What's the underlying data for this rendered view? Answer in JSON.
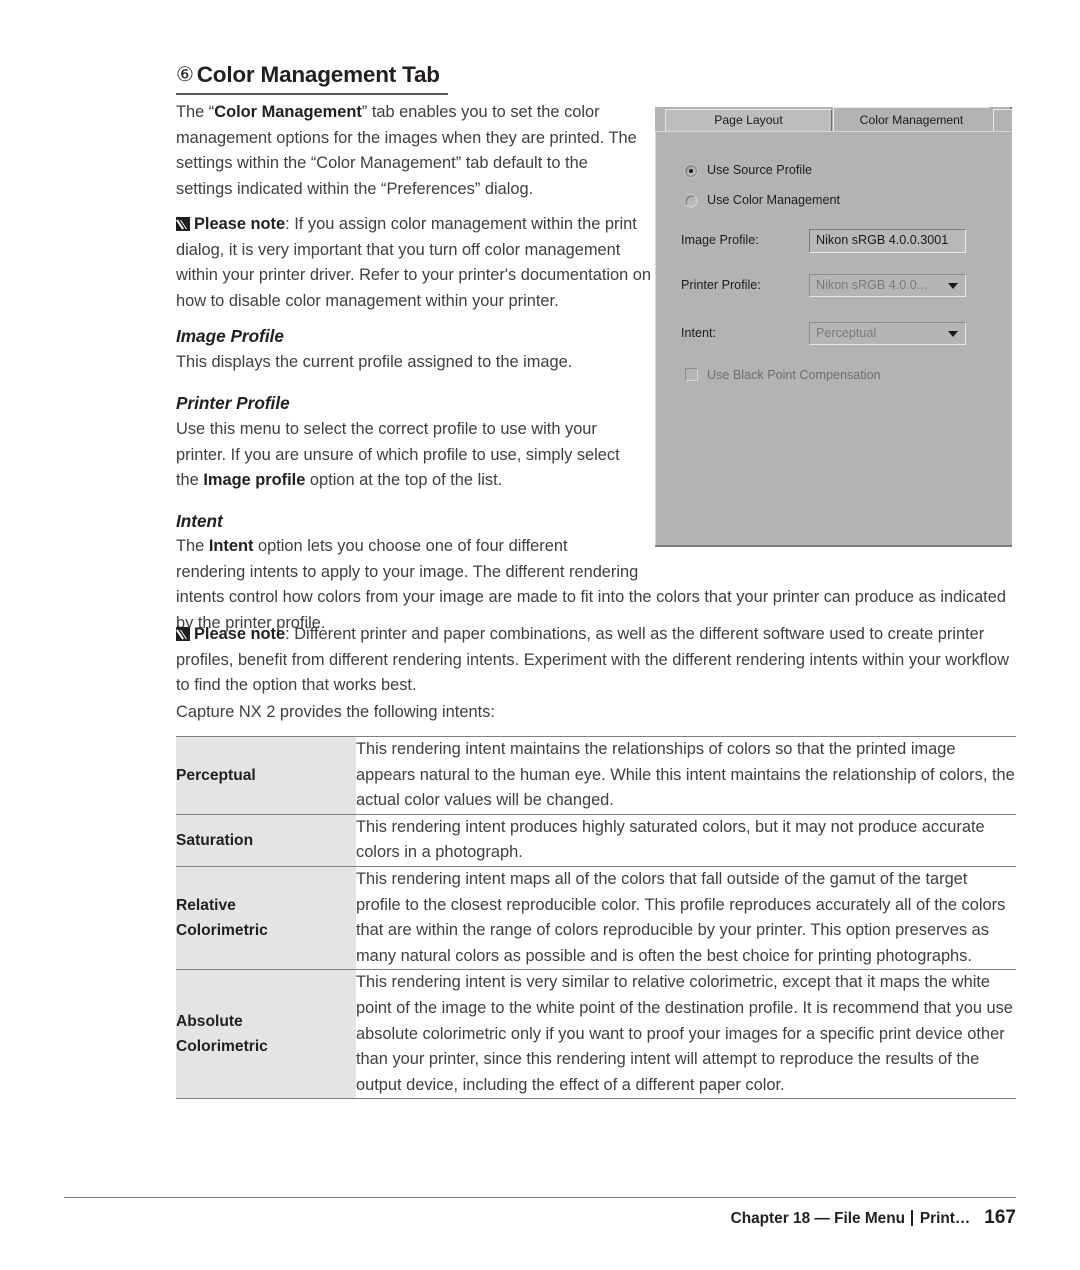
{
  "heading": {
    "marker": "⑥",
    "text": "Color Management Tab"
  },
  "paragraphs": {
    "intro_pre": "The “",
    "intro_bold": "Color Management",
    "intro_post": "” tab enables you to set the color management options for the images when they are printed. The settings within the “Color Management” tab default to the settings indicated within the “Preferences” dialog.",
    "note1_label": "Please note",
    "note1_text": ": If you assign color management within the print dialog, it is very important that you turn off color management within your printer driver. Refer to your printer's documentation on how to disable color management within your printer.",
    "image_profile_body": "This displays the current profile assigned to the image.",
    "printer_profile_pre": "Use this menu to select the correct profile to use with your printer. If you are unsure of which profile to use, simply select the ",
    "printer_profile_bold": "Image profile",
    "printer_profile_post": " option at the top of the list.",
    "intent_pre": "The ",
    "intent_bold": "Intent",
    "intent_post": " option lets you choose one of four different rendering intents to apply to your image. The different rendering intents control how colors from your image are made to fit into the colors that your printer can produce as indicated by the printer profile.",
    "note2_label": "Please note",
    "note2_text": ": Different printer and paper combinations, as well as the different software used to create printer profiles, benefit from different rendering intents. Experiment with the different rendering intents within your workflow to find the option that works best.",
    "capture_line": "Capture NX 2 provides the following intents:"
  },
  "subheads": {
    "image_profile": "Image Profile",
    "printer_profile": "Printer Profile",
    "intent": "Intent"
  },
  "dialog": {
    "tabs": [
      {
        "label": "Page Layout",
        "active": false
      },
      {
        "label": "Color Management",
        "active": true
      }
    ],
    "radios": [
      {
        "label": "Use Source Profile",
        "checked": true
      },
      {
        "label": "Use Color Management",
        "checked": false
      }
    ],
    "fields": [
      {
        "label": "Image Profile:",
        "value": "Nikon sRGB 4.0.0.3001",
        "control": "textfield",
        "disabled": false
      },
      {
        "label": "Printer Profile:",
        "value": "Nikon sRGB 4.0.0...",
        "control": "combobox",
        "disabled": true
      },
      {
        "label": "Intent:",
        "value": "Perceptual",
        "control": "combobox",
        "disabled": true
      }
    ],
    "checkbox": {
      "label": "Use Black Point Compensation",
      "checked": false,
      "disabled": true
    }
  },
  "intents_table": {
    "rows": [
      {
        "name": "Perceptual",
        "description": "This rendering intent maintains the relationships of colors so that the printed image appears natural to the human eye. While this intent maintains the relationship of colors, the actual color values will be changed."
      },
      {
        "name": "Saturation",
        "description": "This rendering intent produces highly saturated colors, but it may not produce accurate colors in a photograph."
      },
      {
        "name": "Relative Colorimetric",
        "description": "This rendering intent maps all of the colors that fall outside of the gamut of the target profile to the closest reproducible color. This profile reproduces accurately all of the colors that are within the range of colors reproducible by your printer. This option preserves as many natural colors as possible and is often the best choice for printing photographs."
      },
      {
        "name": "Absolute Colorimetric",
        "description": "This rendering intent is very similar to relative colorimetric, except that it maps the white point of the image to the white point of the destination profile. It is recommend that you use absolute colorimetric only if you want to proof your images for a specific print device other than your printer, since this rendering intent will attempt to reproduce the results of the output device, including the effect of a different paper color."
      }
    ]
  },
  "footer": {
    "chapter": "Chapter 18 — File Menu",
    "topic": "Print…",
    "page_number": "167"
  },
  "colors": {
    "text": "#3f3f41",
    "heading": "#231f20",
    "rule": "#808183",
    "table_name_bg": "#e4e4e4",
    "dialog_bg": "#b3b3b3"
  }
}
